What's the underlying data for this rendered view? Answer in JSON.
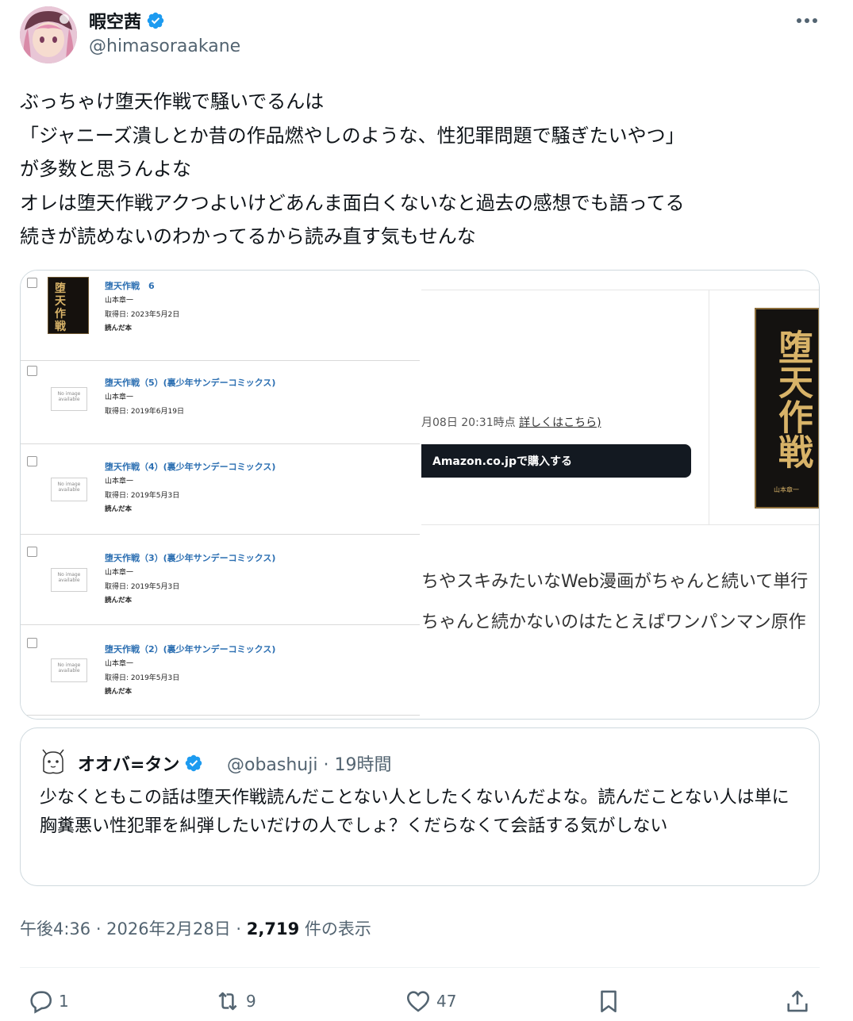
{
  "author": {
    "name": "暇空茜",
    "handle": "@himasoraakane"
  },
  "post": {
    "lines": [
      "ぶっちゃけ堕天作戦で騒いでるんは",
      "「ジャニーズ潰しとか昔の作品燃やしのような、性犯罪問題で騒ぎたいやつ」",
      "が多数と思うんよな",
      "オレは堕天作戦アクつよいけどあんま面白くないなと過去の感想でも語ってる",
      "続きが読めないのわかってるから読み直す気もせんな"
    ]
  },
  "media": {
    "books": [
      {
        "title": "堕天作戦　6",
        "author": "山本章一",
        "date": "取得日: 2023年5月2日",
        "status": "読んだ本"
      },
      {
        "title": "堕天作戦（5）(裏少年サンデーコミックス)",
        "author": "山本章一",
        "date": "取得日: 2019年6月19日",
        "status": ""
      },
      {
        "title": "堕天作戦（4）(裏少年サンデーコミックス)",
        "author": "山本章一",
        "date": "取得日: 2019年5月3日",
        "status": "読んだ本"
      },
      {
        "title": "堕天作戦（3）(裏少年サンデーコミックス)",
        "author": "山本章一",
        "date": "取得日: 2019年5月3日",
        "status": "読んだ本"
      },
      {
        "title": "堕天作戦（2）(裏少年サンデーコミックス)",
        "author": "山本章一",
        "date": "取得日: 2019年5月3日",
        "status": "読んだ本"
      }
    ],
    "no_image_label": "No image available",
    "price_time": "月08日 20:31時点",
    "details_link": "詳しくはこちら)",
    "buy_button": "Amazon.co.jpで購入する",
    "cover_title": "堕天作戦",
    "cover_author": "山本章一",
    "text_line_1": "ちやスキみたいなWeb漫画がちゃんと続いて単行",
    "text_line_2": "ちゃんと続かないのはたとえばワンパンマン原作"
  },
  "quote": {
    "name": "オオバ=タン",
    "meta": "@obashuji · 19時間",
    "text": "少なくともこの話は堕天作戦読んだことない人としたくないんだよな。読んだことない人は単に胸糞悪い性犯罪を糾弾したいだけの人でしょ？くだらなくて会話する気がしない"
  },
  "timestamp": {
    "time": "午後4:36 · 2026年2月28日 · ",
    "views_count": "2,719",
    "views_label": " 件の表示"
  },
  "actions": {
    "replies": "1",
    "reposts": "9",
    "likes": "47"
  },
  "colors": {
    "verified": "#1d9bf0",
    "secondary": "#536471",
    "border": "#cfd9de"
  }
}
